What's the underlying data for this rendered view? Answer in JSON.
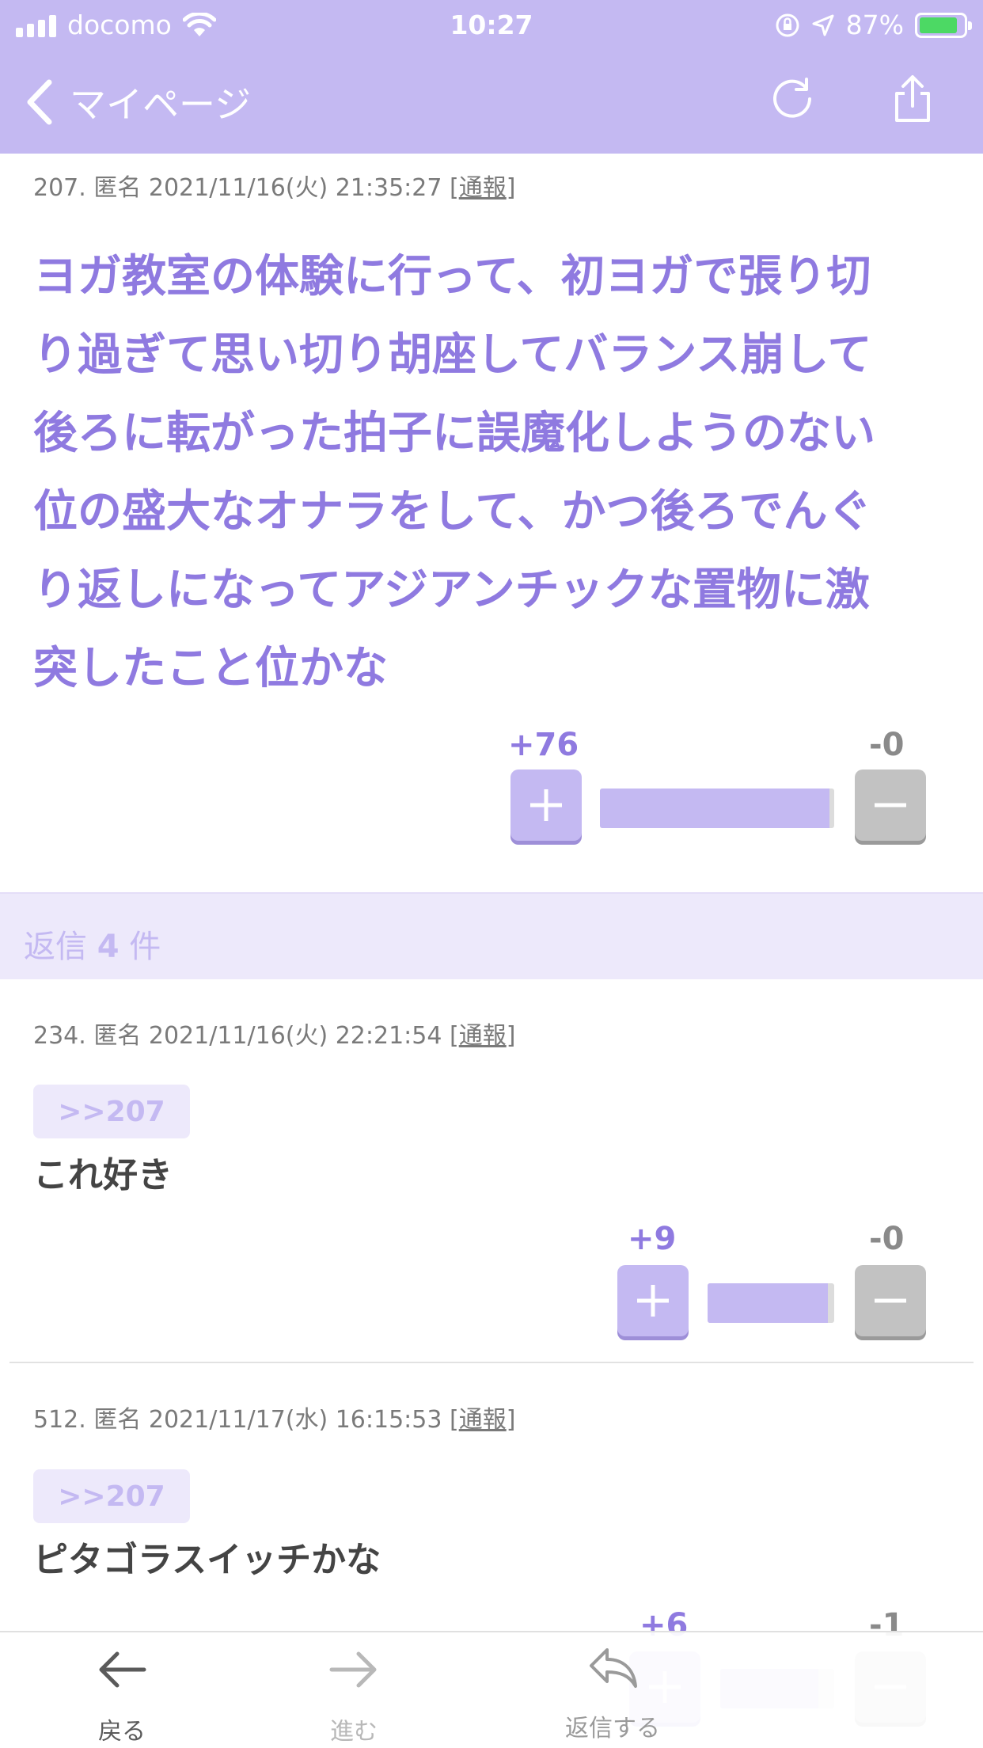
{
  "status_bar": {
    "carrier": "docomo",
    "time": "10:27",
    "battery": "87%",
    "battery_level": 0.87
  },
  "nav": {
    "back_label": "マイページ"
  },
  "main_post": {
    "meta": "207. 匿名 2021/11/16(火) 21:35:27 [",
    "report": "通報",
    "meta_close": "]",
    "body_lines": [
      "ヨガ教室の体験に行って、初ヨガで張り切",
      "り過ぎて思い切り胡座してバランス崩して",
      "後ろに転がった拍子に誤魔化しようのない",
      "位の盛大なオナラをして、かつ後ろでんぐ",
      "り返しになってアジアンチックな置物に激",
      "突したこと位かな"
    ],
    "plus": "+76",
    "minus": "-0",
    "ratio": 0.98
  },
  "replies_header": {
    "prefix": "返信 ",
    "count": "4",
    "suffix": " 件"
  },
  "replies": [
    {
      "meta": "234. 匿名 2021/11/16(火) 22:21:54 [",
      "report": "通報",
      "meta_close": "]",
      "anchor": ">>207",
      "body": "これ好き",
      "plus": "+9",
      "minus": "-0",
      "ratio": 0.95
    },
    {
      "meta": "512. 匿名 2021/11/17(水) 16:15:53 [",
      "report": "通報",
      "meta_close": "]",
      "anchor": ">>207",
      "body": "ピタゴラスイッチかな",
      "plus": "+6",
      "minus": "-1",
      "ratio": 0.86
    }
  ],
  "toolbar": {
    "back": "戻る",
    "forward": "進む",
    "reply": "返信する"
  },
  "colors": {
    "accent": "#c4b9f2",
    "accent_text": "#8f7ae0",
    "minus": "#c2c2c2"
  }
}
